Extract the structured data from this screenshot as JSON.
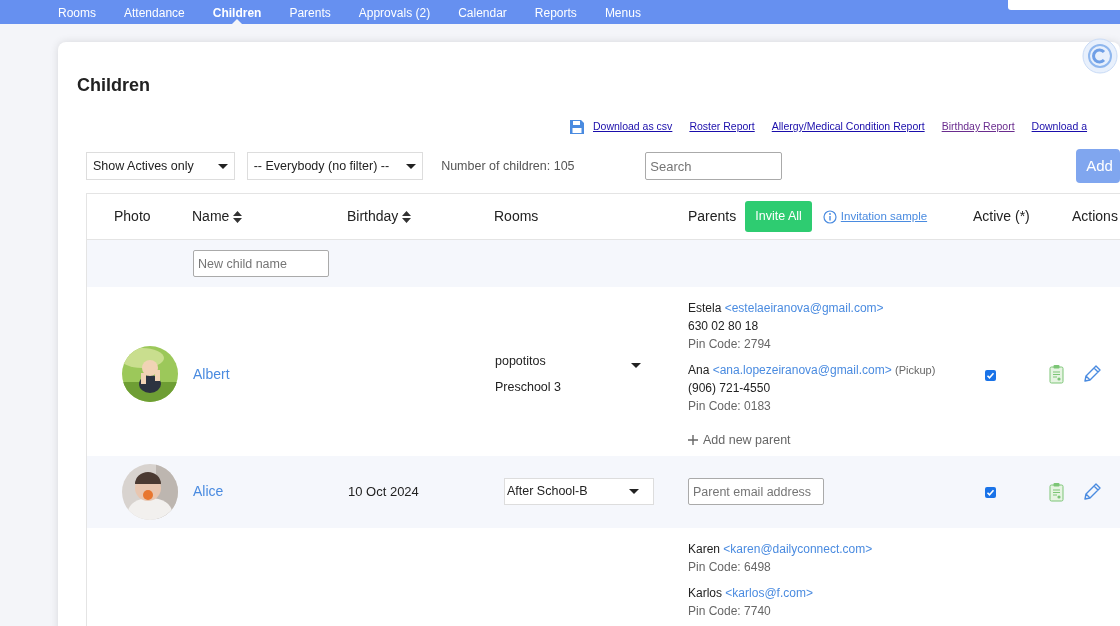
{
  "nav": {
    "tabs": [
      {
        "label": "Rooms",
        "selected": false
      },
      {
        "label": "Attendance",
        "selected": false
      },
      {
        "label": "Children",
        "selected": true
      },
      {
        "label": "Parents",
        "selected": false
      },
      {
        "label": "Approvals (2)",
        "selected": false
      },
      {
        "label": "Calendar",
        "selected": false
      },
      {
        "label": "Reports",
        "selected": false
      },
      {
        "label": "Menus",
        "selected": false
      }
    ]
  },
  "page": {
    "title": "Children"
  },
  "links": [
    {
      "kind": "csv",
      "label": "Download as csv",
      "visited": false
    },
    {
      "kind": "plain",
      "label": "Roster Report",
      "visited": false
    },
    {
      "kind": "plain",
      "label": "Allergy/Medical Condition Report",
      "visited": false
    },
    {
      "kind": "plain",
      "label": "Birthday Report",
      "visited": true
    },
    {
      "kind": "plain",
      "label": "Download a",
      "visited": false
    }
  ],
  "filters": {
    "status": "Show Actives only",
    "group": "-- Everybody (no filter) --",
    "count": "Number of children: 105",
    "search_placeholder": "Search",
    "add_button": "Add"
  },
  "table": {
    "columns": [
      {
        "label": "Photo",
        "sortable": false
      },
      {
        "label": "Name",
        "sortable": true
      },
      {
        "label": "Birthday",
        "sortable": true
      },
      {
        "label": "Rooms",
        "sortable": false
      },
      {
        "label": "Parents",
        "sortable": false
      },
      {
        "label": "Active (*)",
        "sortable": false
      },
      {
        "label": "Actions",
        "sortable": false
      }
    ],
    "invite_all": "Invite All",
    "invitation_sample": "Invitation sample",
    "new_child_placeholder": "New child name",
    "rows": [
      {
        "name": "Albert",
        "rooms": {
          "kind": "list",
          "items": [
            "popotitos",
            "Preschool 3"
          ]
        },
        "parents": {
          "kind": "list",
          "items": [
            {
              "name": "Estela",
              "email": "<estelaeiranova@gmail.com>",
              "phone": "630 02 80 18",
              "pin": "Pin Code: 2794"
            },
            {
              "name": "Ana",
              "email": "<ana.lopezeiranova@gmail.com>",
              "note": "(Pickup)",
              "phone": "(906) 721-4550",
              "pin": "Pin Code: 0183"
            }
          ],
          "add_label": "Add new parent"
        },
        "active": true
      },
      {
        "name": "Alice",
        "birthday": "10 Oct 2024",
        "rooms": {
          "kind": "select",
          "value": "After School-B"
        },
        "parents": {
          "kind": "invite",
          "placeholder": "Parent email address"
        },
        "active": true
      },
      {
        "parents": {
          "kind": "list",
          "items": [
            {
              "name": "Karen",
              "email": "<karen@dailyconnect.com>",
              "pin": "Pin Code: 6498"
            },
            {
              "name": "Karlos",
              "email": "<karlos@f.com>",
              "pin": "Pin Code: 7740"
            }
          ]
        }
      }
    ]
  }
}
